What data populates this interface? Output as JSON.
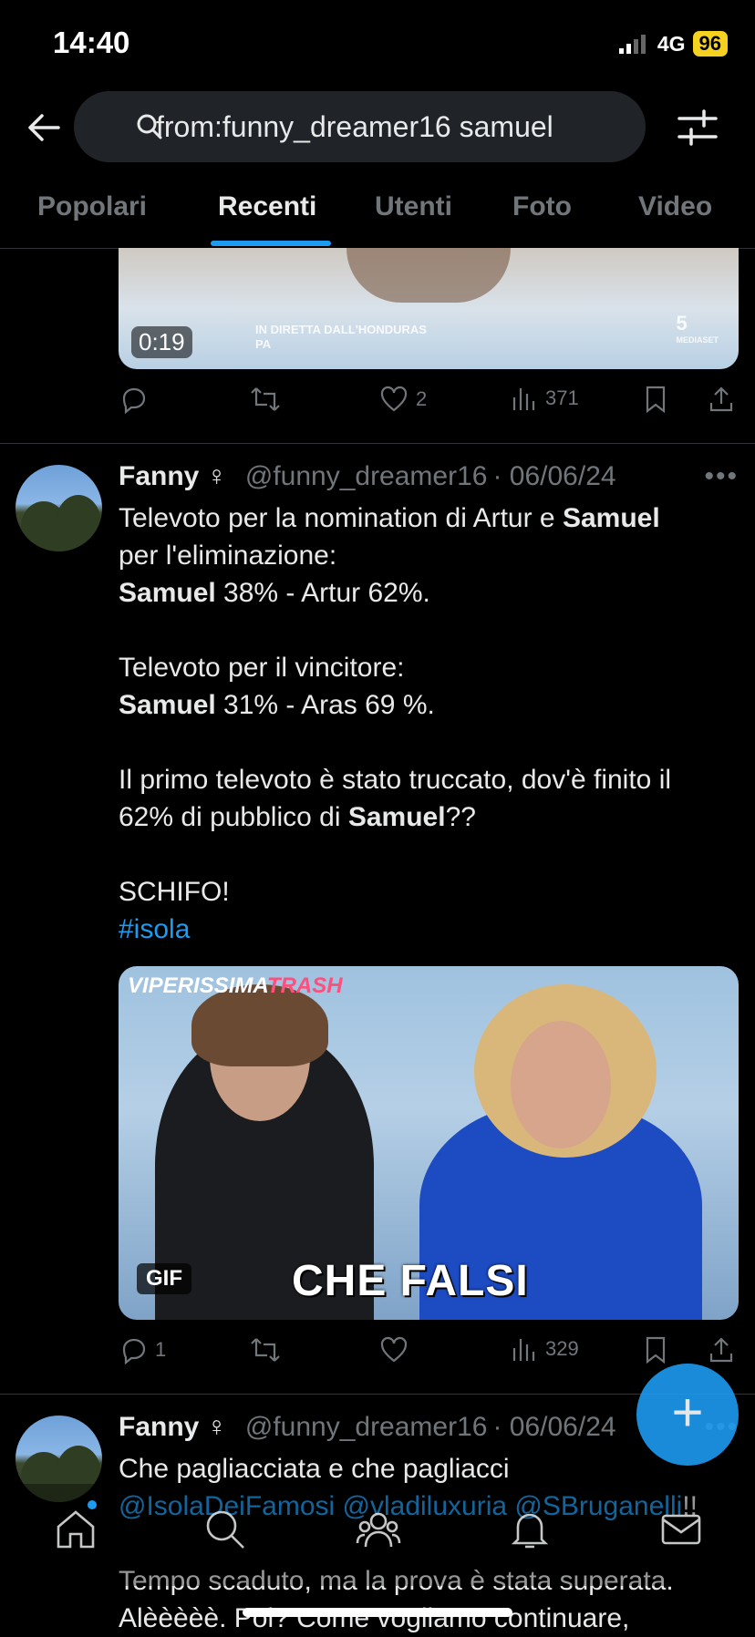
{
  "status": {
    "time": "14:40",
    "network": "4G",
    "battery": "96"
  },
  "header": {
    "search_query": "from:funny_dreamer16 samuel"
  },
  "tabs": [
    {
      "label": "Popolari"
    },
    {
      "label": "Recenti"
    },
    {
      "label": "Utenti"
    },
    {
      "label": "Foto"
    },
    {
      "label": "Video"
    }
  ],
  "tweet1": {
    "media_duration": "0:19",
    "media_overlay": "IN DIRETTA DALL'HONDURAS",
    "media_overlay_2": "PA",
    "media_logo": "5",
    "media_sublogo": "MEDIASET",
    "likes": "2",
    "views": "371"
  },
  "tweet2": {
    "name": "Fanny",
    "symbol": "♀",
    "handle": "@funny_dreamer16",
    "date": "· 06/06/24",
    "line1_pre": "Televoto per la nomination di Artur e ",
    "line1_bold": "Samuel",
    "line2": "per l'eliminazione:",
    "line3_bold": "Samuel",
    "line3_rest": " 38% - Artur 62%.",
    "line4": "Televoto per il vincitore:",
    "line5_bold": "Samuel",
    "line5_rest": " 31% - Aras 69 %.",
    "line6": "Il primo televoto è stato truccato, dov'è finito il",
    "line7_pre": "62% di pubblico di ",
    "line7_bold": "Samuel",
    "line7_post": "??",
    "line8": "SCHIFO!",
    "hashtag": "#isola",
    "gif_brand_a": "VIPERISSIMA",
    "gif_brand_b": "TRASH",
    "gif_caption": "CHE FALSI",
    "gif_badge": "GIF",
    "replies": "1",
    "views": "329"
  },
  "tweet3": {
    "name": "Fanny",
    "symbol": "♀",
    "handle": "@funny_dreamer16",
    "date": "· 06/06/24",
    "line1": "Che pagliacciata e che pagliacci",
    "mention1": "@IsolaDeiFamosi",
    "mention2": "@vladiluxuria",
    "mention3": "@SBruganelli",
    "line2_post": "!!",
    "line3": "Tempo scaduto, ma la prova è stata superata.",
    "line4": "Alèèèèè. Poi? Come vogliamo continuare,"
  },
  "fab": {
    "label": "+"
  },
  "colors": {
    "accent": "#1d9bf0",
    "background": "#000000",
    "muted": "#71767b"
  }
}
